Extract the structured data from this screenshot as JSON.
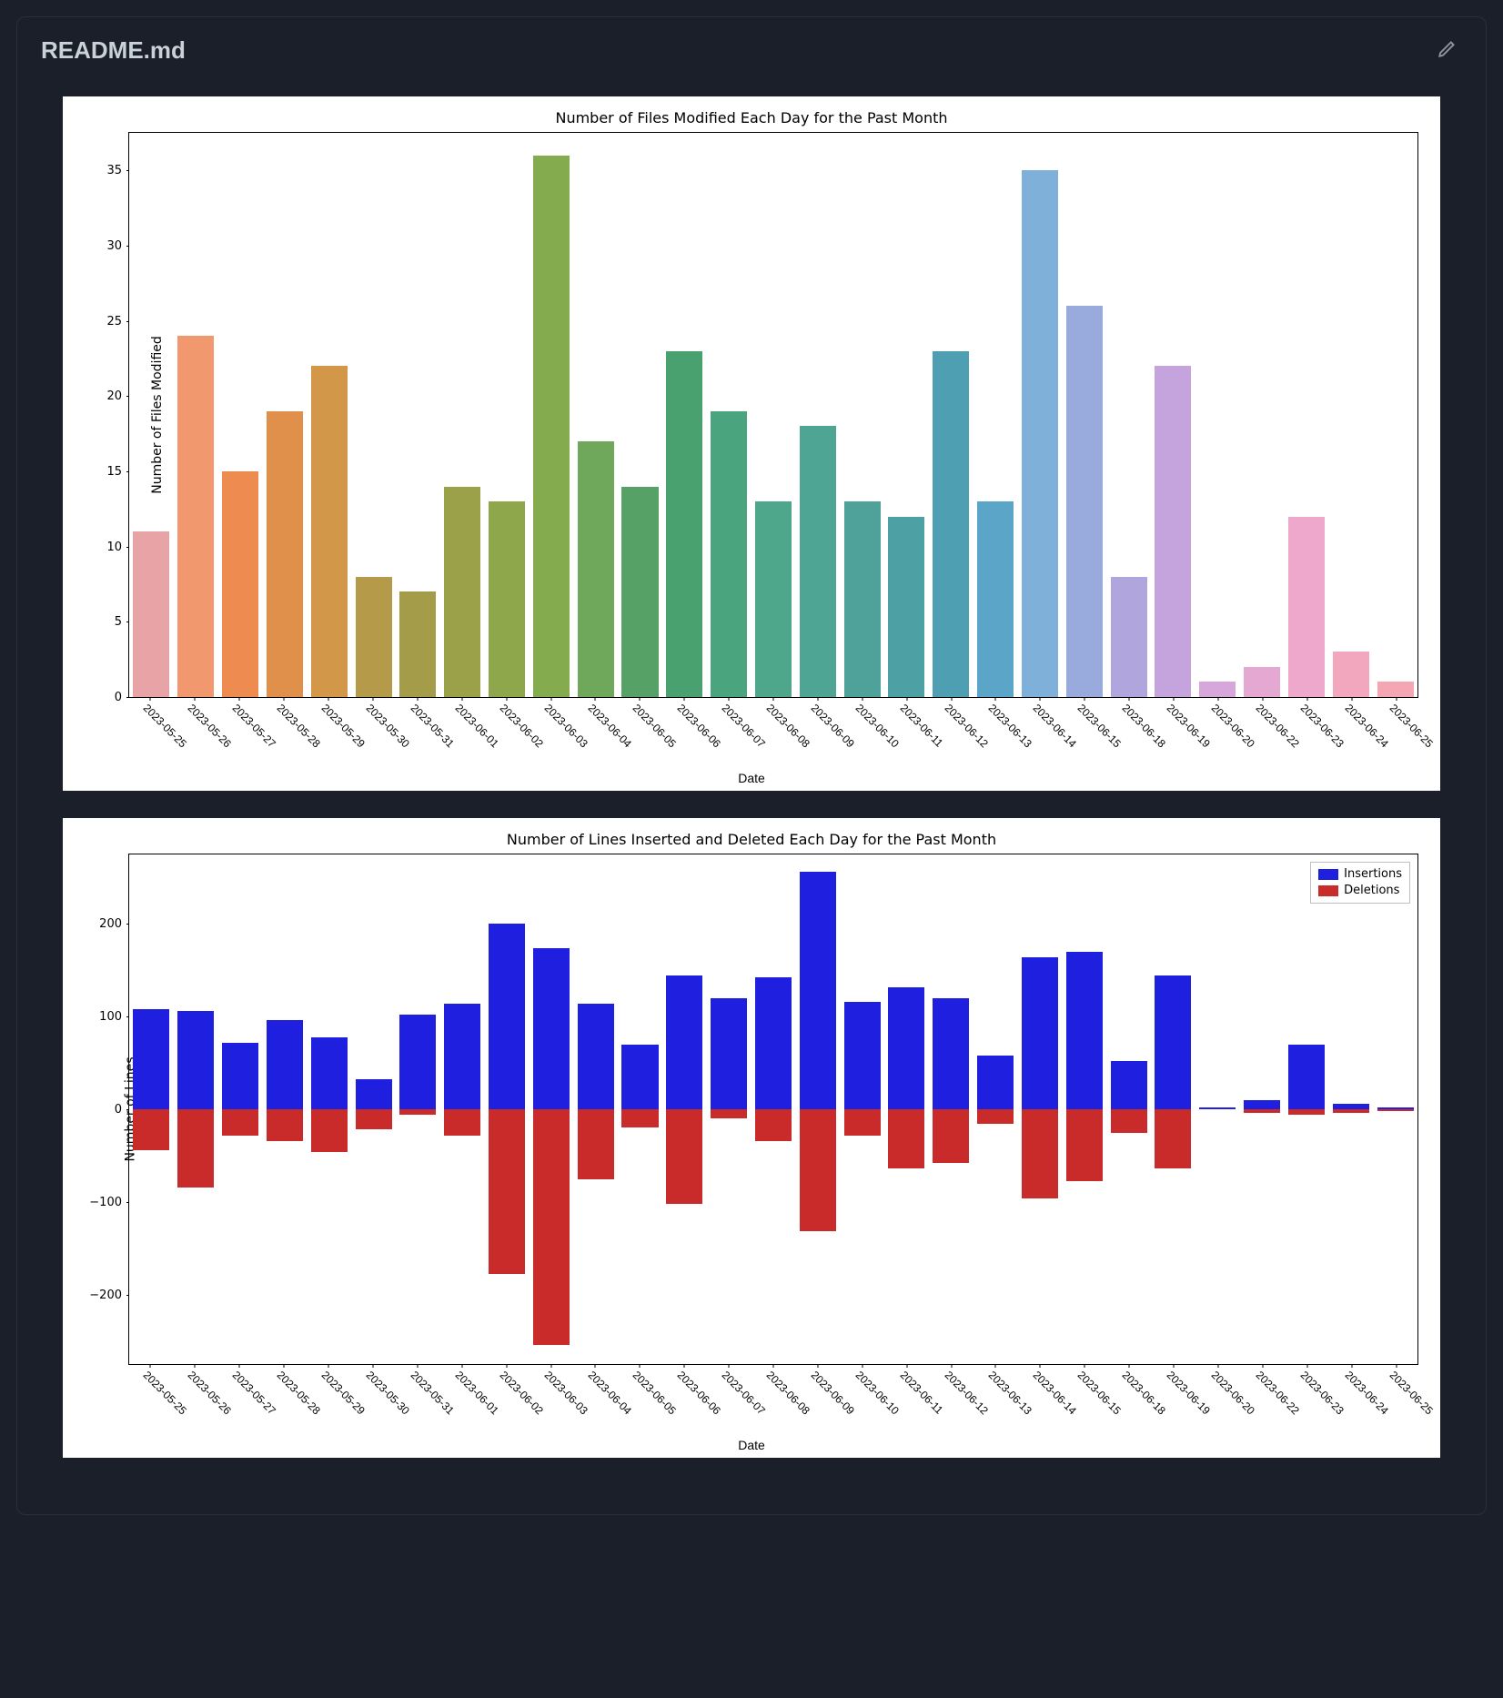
{
  "header": {
    "title": "README.md",
    "edit_button": "Edit"
  },
  "chart_data": [
    {
      "type": "bar",
      "title": "Number of Files Modified Each Day for the Past Month",
      "xlabel": "Date",
      "ylabel": "Number of Files Modified",
      "categories": [
        "2023-05-25",
        "2023-05-26",
        "2023-05-27",
        "2023-05-28",
        "2023-05-29",
        "2023-05-30",
        "2023-05-31",
        "2023-06-01",
        "2023-06-02",
        "2023-06-03",
        "2023-06-04",
        "2023-06-05",
        "2023-06-06",
        "2023-06-07",
        "2023-06-08",
        "2023-06-09",
        "2023-06-10",
        "2023-06-11",
        "2023-06-12",
        "2023-06-13",
        "2023-06-14",
        "2023-06-15",
        "2023-06-18",
        "2023-06-19",
        "2023-06-20",
        "2023-06-22",
        "2023-06-23",
        "2023-06-24",
        "2023-06-25"
      ],
      "values": [
        11,
        24,
        15,
        19,
        22,
        8,
        7,
        14,
        13,
        36,
        17,
        14,
        23,
        19,
        13,
        18,
        13,
        12,
        23,
        13,
        35,
        26,
        8,
        22,
        1,
        2,
        12,
        3,
        1
      ],
      "y_ticks": [
        0,
        5,
        10,
        15,
        20,
        25,
        30,
        35
      ],
      "ylim": [
        0,
        37.5
      ],
      "bar_colors": [
        "#e7a3a6",
        "#f1986f",
        "#ee8b51",
        "#e0904a",
        "#d3974a",
        "#b59a49",
        "#a49c49",
        "#9aa149",
        "#8fa74b",
        "#84ac4e",
        "#6fa75b",
        "#55a166",
        "#4aa170",
        "#4aa47e",
        "#4ea78a",
        "#4fa593",
        "#4fa29a",
        "#4da0a3",
        "#4e9fb1",
        "#5ba6c8",
        "#7fb0da",
        "#99abdd",
        "#b1a5dd",
        "#c5a4dd",
        "#d7a6da",
        "#e4a8d3",
        "#eea8cb",
        "#f3a7bf",
        "#f4a6b3"
      ]
    },
    {
      "type": "bar",
      "title": "Number of Lines Inserted and Deleted Each Day for the Past Month",
      "xlabel": "Date",
      "ylabel": "Number of Lines",
      "categories": [
        "2023-05-25",
        "2023-05-26",
        "2023-05-27",
        "2023-05-28",
        "2023-05-29",
        "2023-05-30",
        "2023-05-31",
        "2023-06-01",
        "2023-06-02",
        "2023-06-03",
        "2023-06-04",
        "2023-06-05",
        "2023-06-06",
        "2023-06-07",
        "2023-06-08",
        "2023-06-09",
        "2023-06-10",
        "2023-06-11",
        "2023-06-12",
        "2023-06-13",
        "2023-06-14",
        "2023-06-15",
        "2023-06-18",
        "2023-06-19",
        "2023-06-20",
        "2023-06-22",
        "2023-06-23",
        "2023-06-24",
        "2023-06-25"
      ],
      "series": [
        {
          "name": "Insertions",
          "color": "#1f1fdf",
          "values": [
            108,
            106,
            72,
            96,
            78,
            32,
            102,
            114,
            200,
            174,
            114,
            70,
            144,
            120,
            142,
            256,
            116,
            132,
            120,
            58,
            164,
            170,
            52,
            144,
            2,
            10,
            70,
            6,
            2
          ]
        },
        {
          "name": "Deletions",
          "color": "#c92a2a",
          "values": [
            -44,
            -84,
            -28,
            -34,
            -46,
            -22,
            -6,
            -28,
            -178,
            -254,
            -76,
            -20,
            -102,
            -10,
            -34,
            -132,
            -28,
            -64,
            -58,
            -16,
            -96,
            -78,
            -26,
            -64,
            0,
            -4,
            -6,
            -4,
            -2
          ]
        }
      ],
      "y_ticks": [
        -200,
        -100,
        0,
        100,
        200
      ],
      "ylim": [
        -275,
        275
      ],
      "legend": {
        "entries": [
          "Insertions",
          "Deletions"
        ]
      }
    }
  ]
}
